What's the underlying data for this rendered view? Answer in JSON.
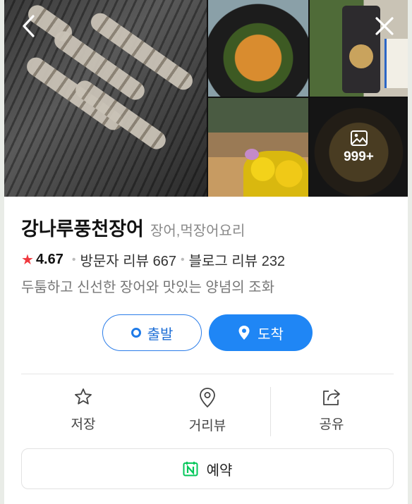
{
  "gallery": {
    "more_count": "999+",
    "back_icon": "chevron-left-icon",
    "close_icon": "close-icon",
    "photo_icon": "image-icon"
  },
  "place": {
    "name": "강나루풍천장어",
    "category": "장어,먹장어요리",
    "rating": "4.67",
    "visitor_reviews": "방문자 리뷰 667",
    "blog_reviews": "블로그 리뷰 232",
    "description": "두툼하고 신선한 장어와 맛있는 양념의 조화"
  },
  "route": {
    "start_label": "출발",
    "arrive_label": "도착"
  },
  "actions": [
    {
      "label": "저장",
      "icon": "star-outline-icon"
    },
    {
      "label": "거리뷰",
      "icon": "location-pin-icon"
    },
    {
      "label": "공유",
      "icon": "share-icon"
    }
  ],
  "reserve": {
    "label": "예약",
    "icon": "naver-calendar-icon"
  },
  "colors": {
    "accent_blue": "#1f86f5",
    "star_red": "#f0383e",
    "naver_green": "#03c75a"
  }
}
